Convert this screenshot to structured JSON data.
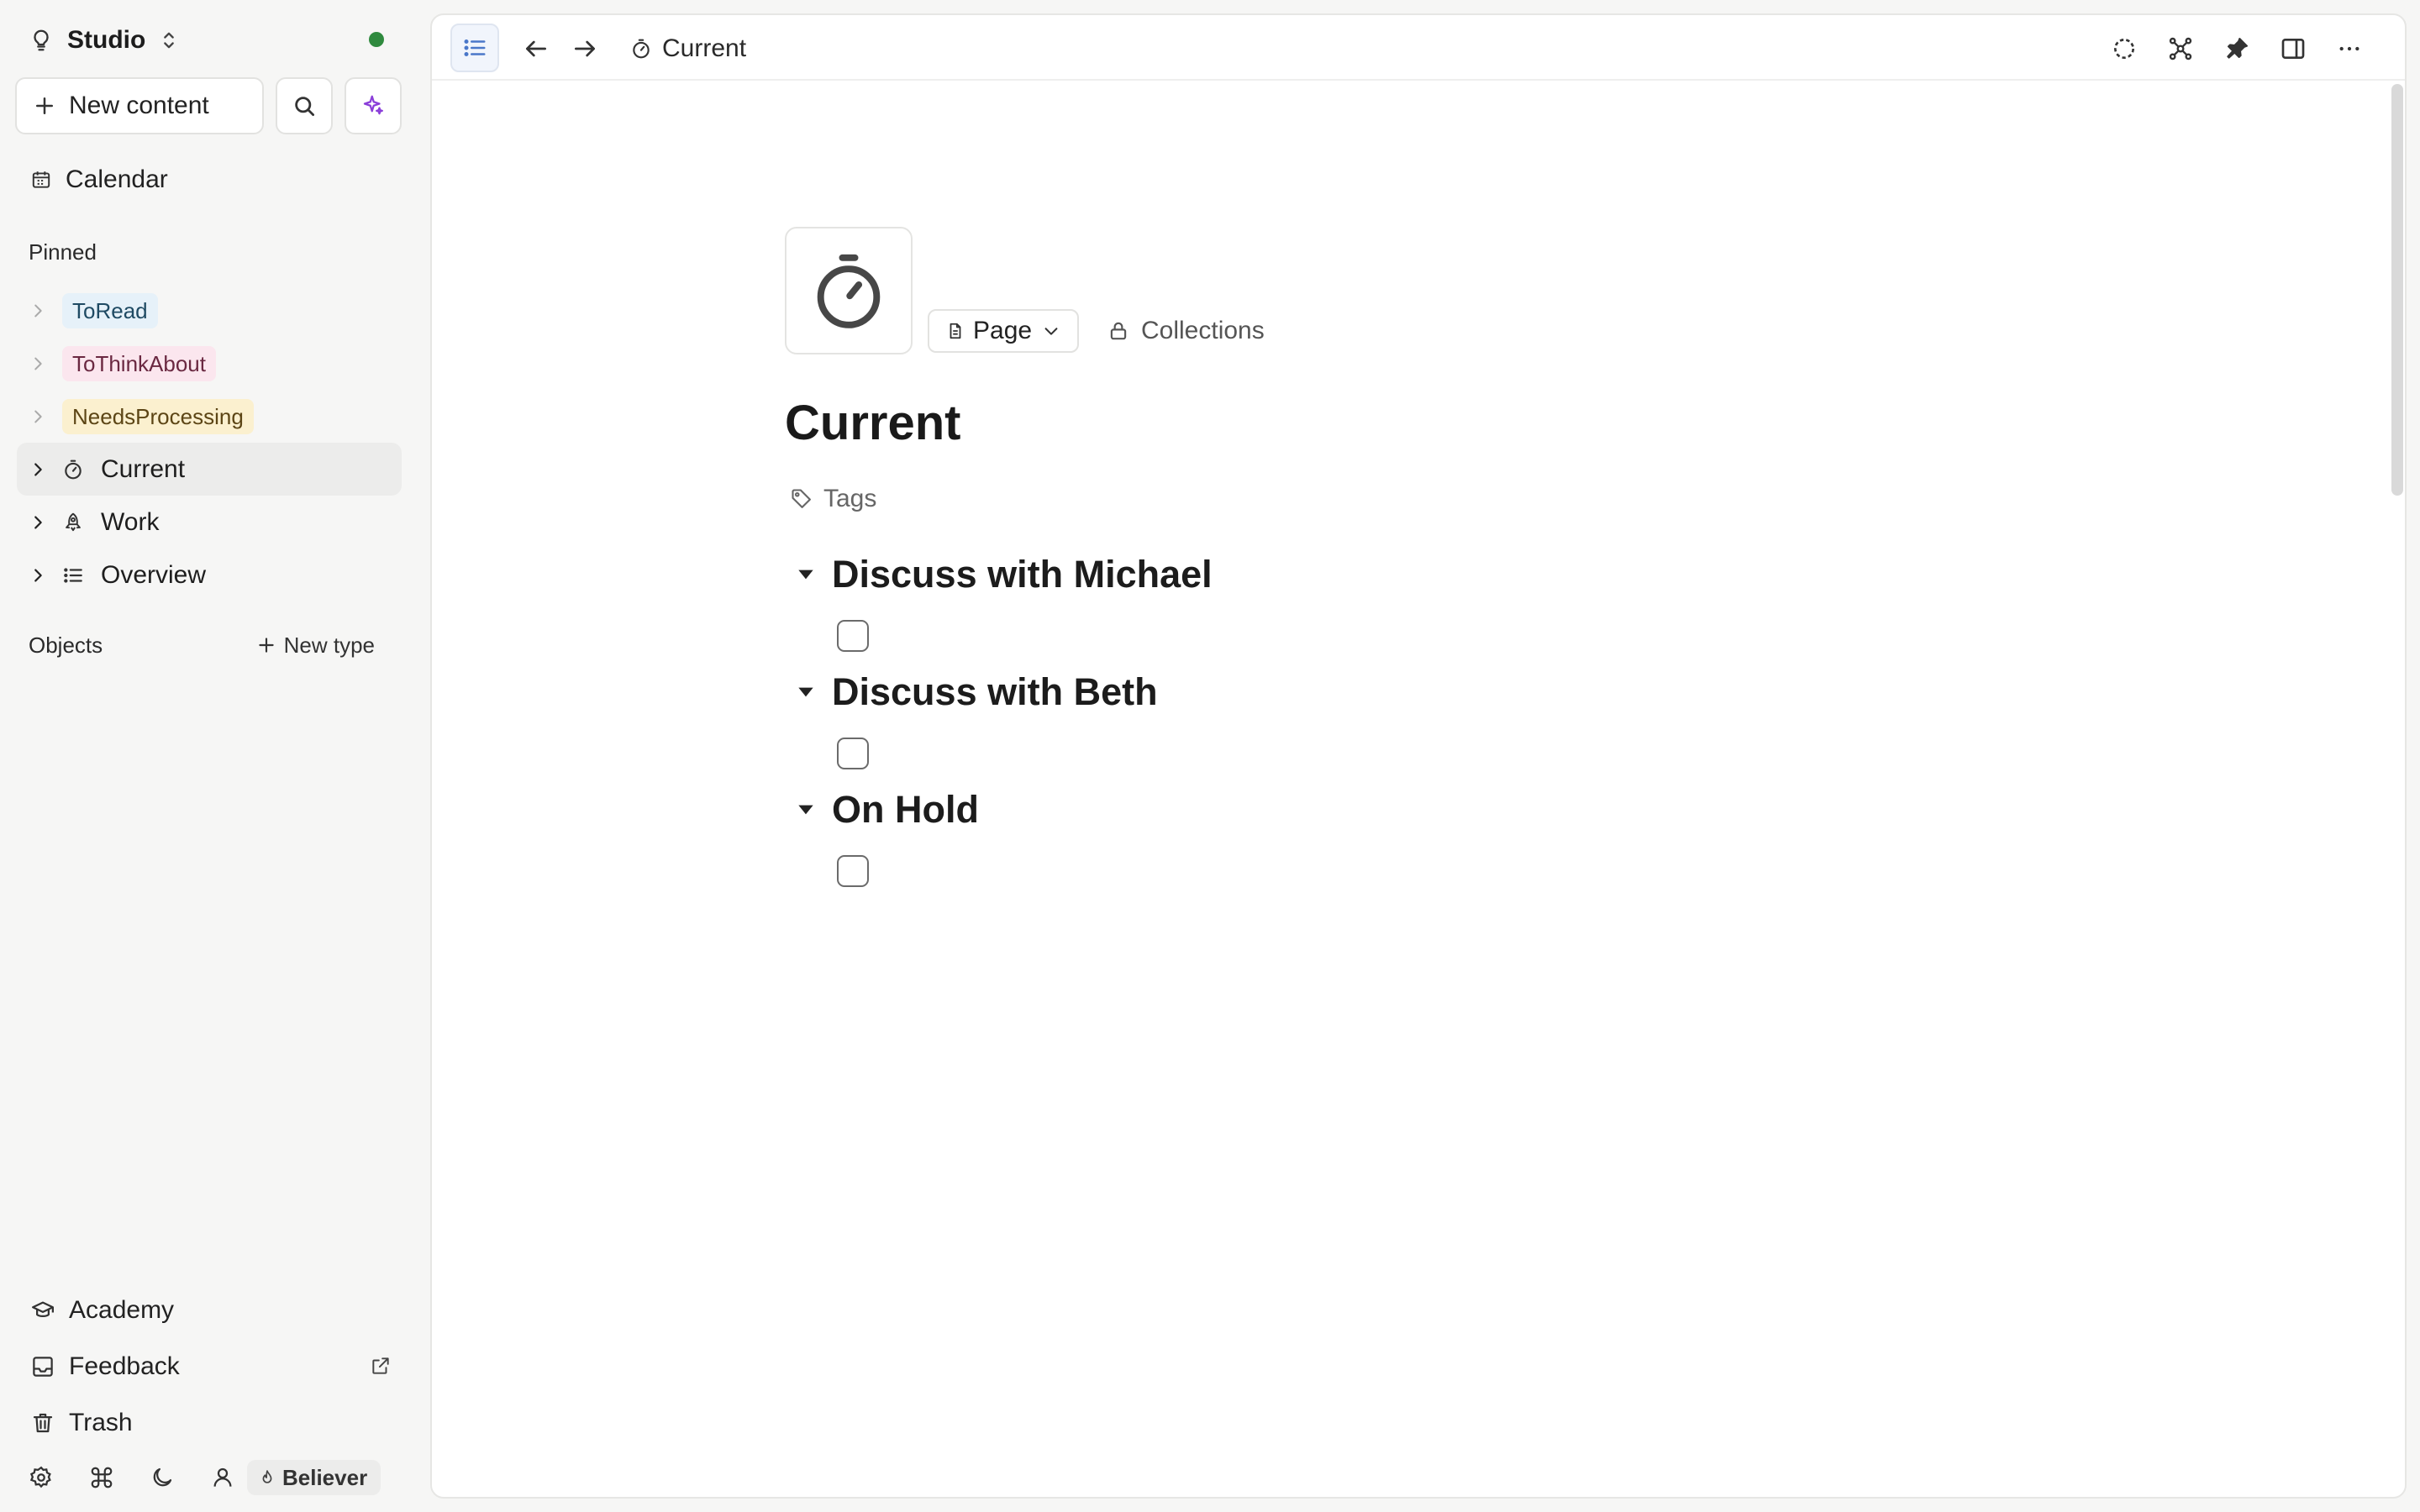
{
  "workspace": {
    "name": "Studio"
  },
  "sidebar": {
    "new_content_label": "New content",
    "calendar_label": "Calendar",
    "pinned_label": "Pinned",
    "pinned": [
      {
        "label": "ToRead",
        "chip_bg": "#e6f1f9",
        "chip_fg": "#1f4a63"
      },
      {
        "label": "ToThinkAbout",
        "chip_bg": "#fbe6ee",
        "chip_fg": "#6a2841"
      },
      {
        "label": "NeedsProcessing",
        "chip_bg": "#fbf0cf",
        "chip_fg": "#5c4515"
      }
    ],
    "objects": [
      {
        "label": "Current",
        "icon": "stopwatch-icon"
      },
      {
        "label": "Work",
        "icon": "rocket-icon"
      },
      {
        "label": "Overview",
        "icon": "list-icon"
      }
    ],
    "objects_label": "Objects",
    "new_type_label": "New type",
    "bottom": {
      "academy": "Academy",
      "feedback": "Feedback",
      "trash": "Trash"
    },
    "membership_badge": "Believer"
  },
  "topbar": {
    "breadcrumb": "Current"
  },
  "page": {
    "title": "Current",
    "type_label": "Page",
    "collections_label": "Collections",
    "tags_label": "Tags",
    "toggles": [
      {
        "title": "Discuss with Michael",
        "checked": false
      },
      {
        "title": "Discuss with Beth",
        "checked": false
      },
      {
        "title": "On Hold",
        "checked": false
      }
    ]
  },
  "colors": {
    "sync_dot": "#2f8a3e",
    "ai_accent": "#8b3fd9",
    "toc_accent": "#4a77c9",
    "panel_bg": "#ffffff",
    "sidebar_bg": "#f6f6f5"
  }
}
